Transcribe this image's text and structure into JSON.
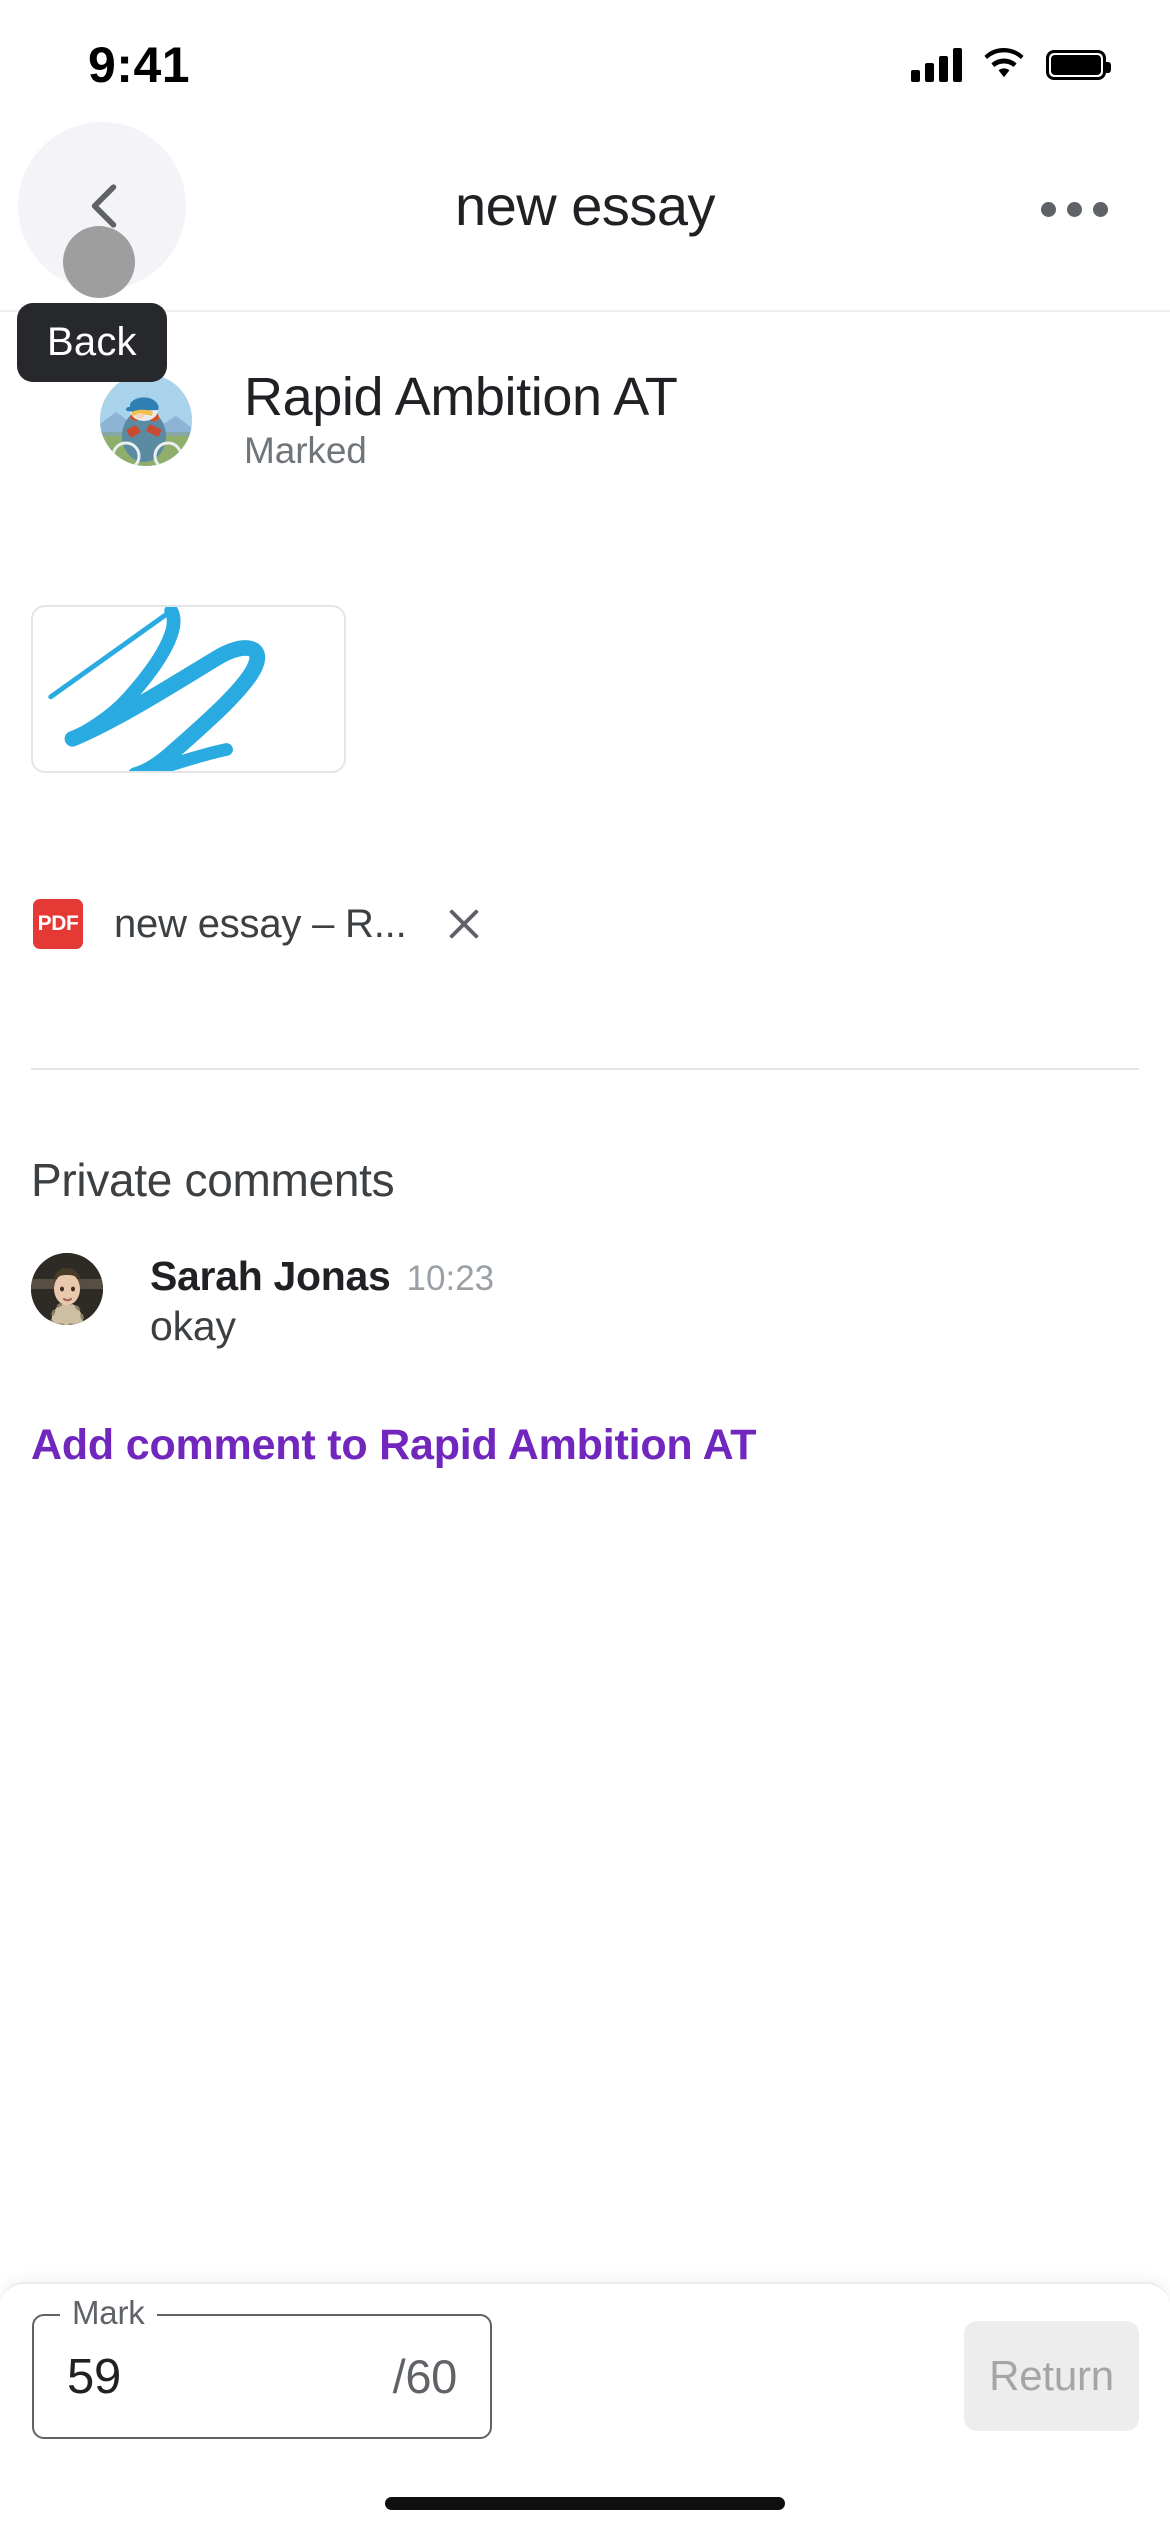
{
  "status_bar": {
    "time": "9:41",
    "signal_icon": "cellular-signal-icon",
    "wifi_icon": "wifi-icon",
    "battery_icon": "battery-full-icon"
  },
  "nav_bar": {
    "title": "new essay",
    "back_icon": "chevron-left-icon",
    "more_icon": "overflow-menu-icon"
  },
  "tooltip": {
    "label": "Back"
  },
  "student": {
    "name": "Rapid Ambition AT",
    "status": "Marked",
    "avatar_icon": "cyclist-avatar"
  },
  "attachment": {
    "thumbnail_icon": "blue-scribble-drawing",
    "file_type_label": "PDF",
    "file_name": "new essay – R...",
    "remove_icon": "close-x-icon",
    "accent_color": "#29abe2",
    "pdf_badge_color": "#e53935"
  },
  "comments": {
    "section_title": "Private comments",
    "items": [
      {
        "author": "Sarah Jonas",
        "time": "10:23",
        "text": "okay",
        "avatar_icon": "person-portrait-avatar"
      }
    ],
    "add_comment_label": "Add comment to Rapid Ambition AT",
    "link_color": "#7126bd"
  },
  "bottom_bar": {
    "mark_label": "Mark",
    "mark_value": "59",
    "mark_total": "/60",
    "return_label": "Return"
  }
}
